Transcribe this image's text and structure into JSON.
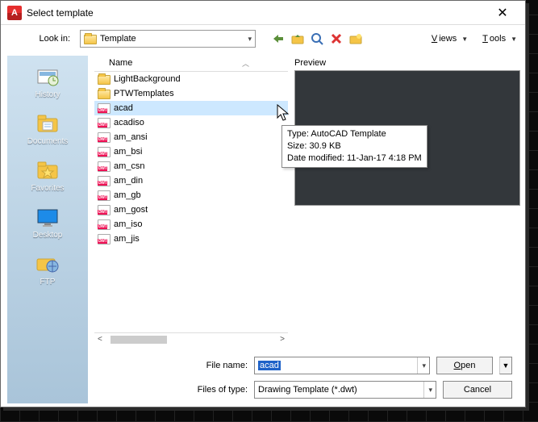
{
  "window": {
    "title": "Select template"
  },
  "lookin": {
    "label": "Look in:",
    "value": "Template"
  },
  "menus": {
    "views": "iews",
    "views_prefix": "V",
    "tools": "ools",
    "tools_prefix": "T"
  },
  "sidebar": {
    "items": [
      {
        "label": "History"
      },
      {
        "label": "Documents"
      },
      {
        "label": "Favorites"
      },
      {
        "label": "Desktop"
      },
      {
        "label": "FTP"
      }
    ]
  },
  "list": {
    "header": "Name",
    "items": [
      {
        "name": "LightBackground",
        "type": "folder"
      },
      {
        "name": "PTWTemplates",
        "type": "folder"
      },
      {
        "name": "acad",
        "type": "dwt",
        "selected": true
      },
      {
        "name": "acadiso",
        "type": "dwt"
      },
      {
        "name": "am_ansi",
        "type": "dwt"
      },
      {
        "name": "am_bsi",
        "type": "dwt"
      },
      {
        "name": "am_csn",
        "type": "dwt"
      },
      {
        "name": "am_din",
        "type": "dwt"
      },
      {
        "name": "am_gb",
        "type": "dwt"
      },
      {
        "name": "am_gost",
        "type": "dwt"
      },
      {
        "name": "am_iso",
        "type": "dwt"
      },
      {
        "name": "am_jis",
        "type": "dwt"
      }
    ]
  },
  "preview": {
    "label": "Preview"
  },
  "tooltip": {
    "line1": "Type: AutoCAD Template",
    "line2": "Size: 30.9 KB",
    "line3": "Date modified: 11-Jan-17 4:18 PM"
  },
  "filename": {
    "label": "File name:",
    "value": "acad"
  },
  "filetype": {
    "label": "Files of type:",
    "value": "Drawing Template (*.dwt)"
  },
  "buttons": {
    "open": "pen",
    "open_prefix": "O",
    "cancel": "Cancel"
  },
  "toolbar_icons": [
    "back-icon",
    "up-icon",
    "search-icon",
    "delete-icon",
    "newfolder-icon"
  ]
}
